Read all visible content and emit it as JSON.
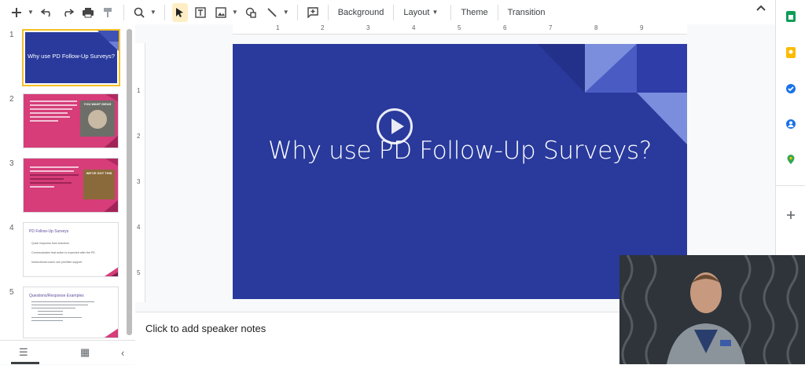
{
  "toolbar": {
    "background_label": "Background",
    "layout_label": "Layout",
    "theme_label": "Theme",
    "transition_label": "Transition"
  },
  "ruler": {
    "top_marks": [
      "1",
      "2",
      "3",
      "4",
      "5",
      "6",
      "7",
      "8",
      "9"
    ],
    "left_marks": [
      "1",
      "2",
      "3",
      "4",
      "5"
    ]
  },
  "filmstrip": {
    "slides": [
      {
        "number": "1",
        "title": "Why use PD Follow-Up Surveys?"
      },
      {
        "number": "2",
        "meme_text": "YOU WANT IDEAS"
      },
      {
        "number": "3",
        "meme_text": "WE'VE GOT THIS"
      },
      {
        "number": "4",
        "title": "PD Follow-Up Surveys",
        "bullets": [
          "Quick response from teachers",
          "Communicates that action is expected after the PD",
          "Instructional coach can prioritize support"
        ]
      },
      {
        "number": "5",
        "title": "Questions/Response Examples"
      }
    ]
  },
  "slide": {
    "title": "Why use PD Follow-Up Surveys?"
  },
  "notes": {
    "placeholder": "Click to add speaker notes"
  },
  "colors": {
    "slide_bg": "#293a9c",
    "pink_slide": "#d63d79",
    "selection": "#f6c026"
  }
}
